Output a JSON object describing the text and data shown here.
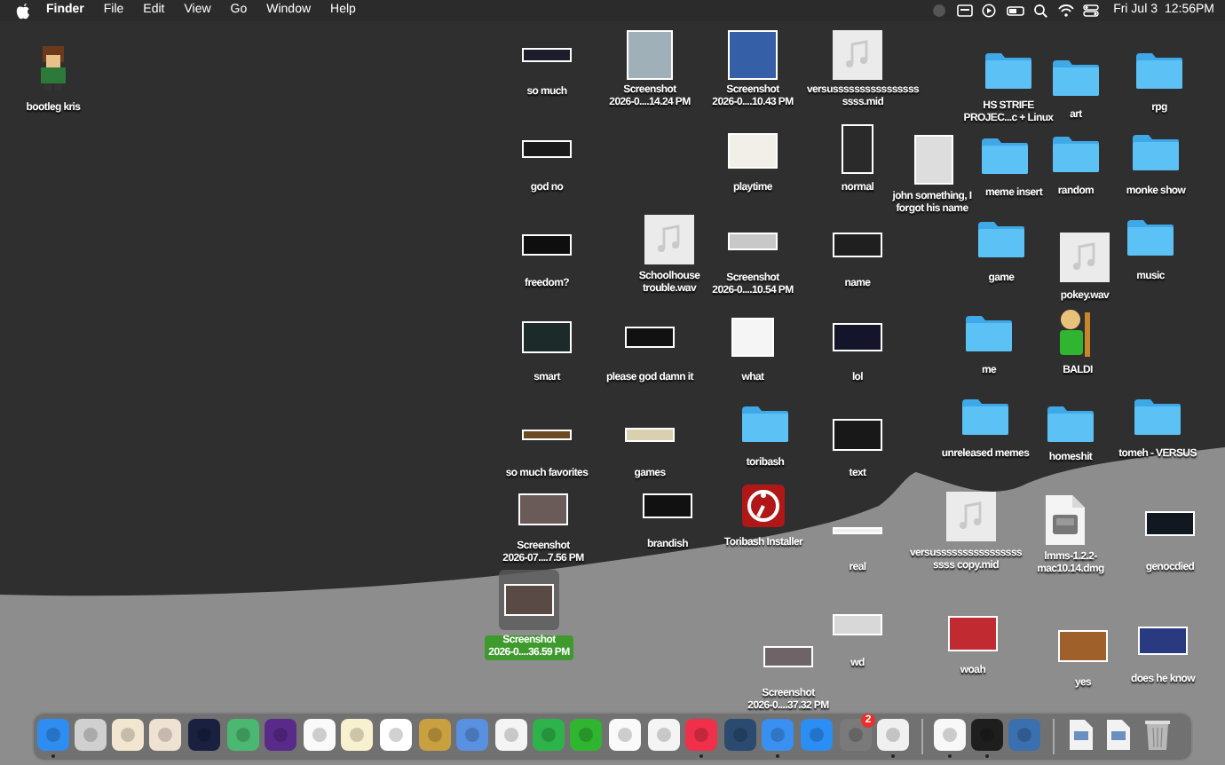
{
  "menu_bar": {
    "app_name": "Finder",
    "menus": [
      "File",
      "Edit",
      "View",
      "Go",
      "Window",
      "Help"
    ],
    "date": "Fri Jul 3",
    "time": "12:56PM"
  },
  "desktop_items": [
    {
      "kind": "character",
      "label": "bootleg kris",
      "selected": false
    },
    {
      "kind": "image",
      "label": "so much",
      "selected": false
    },
    {
      "kind": "image",
      "label": "Screenshot\n2026-0....14.24 PM",
      "selected": false
    },
    {
      "kind": "image",
      "label": "Screenshot\n2026-0....10.43 PM",
      "selected": false
    },
    {
      "kind": "audio",
      "label": "versussssssssssssssss\nssss.mid",
      "selected": false
    },
    {
      "kind": "folder",
      "label": "HS STRIFE\nPROJEC...c + Linux",
      "selected": false
    },
    {
      "kind": "folder",
      "label": "art",
      "selected": false
    },
    {
      "kind": "folder",
      "label": "rpg",
      "selected": false
    },
    {
      "kind": "image",
      "label": "god no",
      "selected": false
    },
    {
      "kind": "image",
      "label": "playtime",
      "selected": false
    },
    {
      "kind": "image",
      "label": "normal",
      "selected": false
    },
    {
      "kind": "image",
      "label": "john something, I\nforgot his name",
      "selected": false
    },
    {
      "kind": "folder",
      "label": "meme insert",
      "selected": false
    },
    {
      "kind": "folder",
      "label": "random",
      "selected": false
    },
    {
      "kind": "folder",
      "label": "monke show",
      "selected": false
    },
    {
      "kind": "image",
      "label": "freedom?",
      "selected": false
    },
    {
      "kind": "audio",
      "label": "Schoolhouse\ntrouble.wav",
      "selected": false
    },
    {
      "kind": "image",
      "label": "Screenshot\n2026-0....10.54 PM",
      "selected": false
    },
    {
      "kind": "image",
      "label": "name",
      "selected": false
    },
    {
      "kind": "folder",
      "label": "game",
      "selected": false
    },
    {
      "kind": "audio",
      "label": "pokey.wav",
      "selected": false
    },
    {
      "kind": "folder",
      "label": "music",
      "selected": false
    },
    {
      "kind": "image",
      "label": "smart",
      "selected": false
    },
    {
      "kind": "image",
      "label": "please god damn it",
      "selected": false
    },
    {
      "kind": "image",
      "label": "what",
      "selected": false
    },
    {
      "kind": "image",
      "label": "lol",
      "selected": false
    },
    {
      "kind": "folder",
      "label": "me",
      "selected": false
    },
    {
      "kind": "character",
      "label": "BALDI",
      "selected": false
    },
    {
      "kind": "image",
      "label": "so much favorites",
      "selected": false
    },
    {
      "kind": "image",
      "label": "games",
      "selected": false
    },
    {
      "kind": "folder",
      "label": "toribash",
      "selected": false
    },
    {
      "kind": "image",
      "label": "text",
      "selected": false
    },
    {
      "kind": "folder",
      "label": "unreleased memes",
      "selected": false
    },
    {
      "kind": "folder",
      "label": "homeshit",
      "selected": false
    },
    {
      "kind": "folder",
      "label": "tomeh - VERSUS",
      "selected": false
    },
    {
      "kind": "image",
      "label": "Screenshot\n2026-07....7.56 PM",
      "selected": false
    },
    {
      "kind": "image",
      "label": "brandish",
      "selected": false
    },
    {
      "kind": "app",
      "label": "Toribash Installer",
      "selected": false
    },
    {
      "kind": "image",
      "label": "real",
      "selected": false
    },
    {
      "kind": "audio",
      "label": "versussssssssssssssss\nssss copy.mid",
      "selected": false
    },
    {
      "kind": "disk-image",
      "label": "lmms-1.2.2-\nmac10.14.dmg",
      "selected": false
    },
    {
      "kind": "image",
      "label": "genocdied",
      "selected": false
    },
    {
      "kind": "image",
      "label": "Screenshot\n2026-0....36.59 PM",
      "selected": true
    },
    {
      "kind": "image",
      "label": "wd",
      "selected": false
    },
    {
      "kind": "image",
      "label": "Screenshot\n2026-0....37.32 PM",
      "selected": false
    },
    {
      "kind": "image",
      "label": "woah",
      "selected": false
    },
    {
      "kind": "image",
      "label": "yes",
      "selected": false
    },
    {
      "kind": "image",
      "label": "does he know",
      "selected": false
    }
  ],
  "dock": {
    "items": [
      {
        "kind": "app",
        "running": true
      },
      {
        "kind": "app",
        "running": false
      },
      {
        "kind": "app",
        "running": false
      },
      {
        "kind": "app",
        "running": false
      },
      {
        "kind": "app",
        "running": false
      },
      {
        "kind": "app",
        "running": false
      },
      {
        "kind": "app",
        "running": false
      },
      {
        "kind": "app",
        "running": false
      },
      {
        "kind": "app",
        "running": false
      },
      {
        "kind": "app",
        "running": false
      },
      {
        "kind": "app",
        "running": false
      },
      {
        "kind": "app",
        "running": false
      },
      {
        "kind": "app",
        "running": false
      },
      {
        "kind": "app",
        "running": false
      },
      {
        "kind": "app",
        "running": false
      },
      {
        "kind": "app",
        "running": false
      },
      {
        "kind": "app",
        "running": false
      },
      {
        "kind": "app",
        "running": true
      },
      {
        "kind": "app",
        "running": false
      },
      {
        "kind": "app",
        "running": true
      },
      {
        "kind": "app",
        "running": false
      },
      {
        "kind": "app",
        "running": false,
        "badge": "2"
      },
      {
        "kind": "app",
        "running": true
      },
      {
        "kind": "app",
        "running": true
      },
      {
        "kind": "app",
        "running": true
      },
      {
        "kind": "app",
        "running": false
      },
      {
        "kind": "document",
        "running": false
      },
      {
        "kind": "document",
        "running": false
      },
      {
        "kind": "trash",
        "running": false
      }
    ]
  }
}
